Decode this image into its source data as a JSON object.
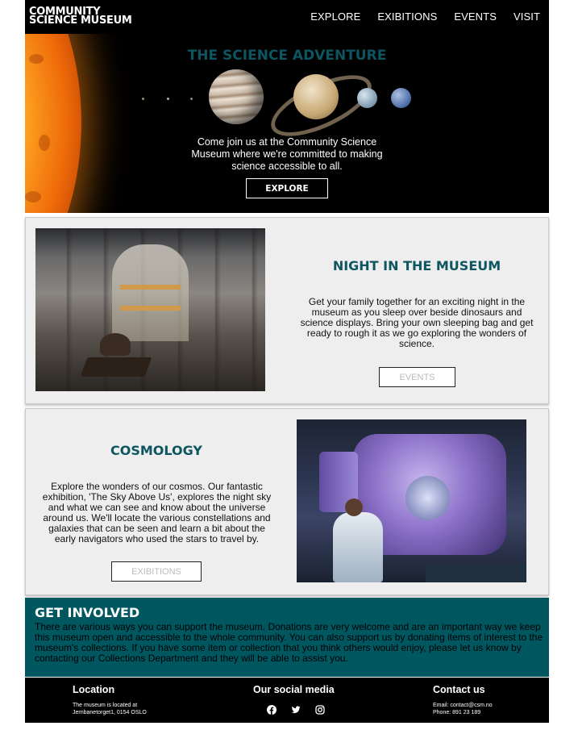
{
  "header": {
    "logo_line1": "COMMUNITY",
    "logo_line2": "SCIENCE MUSEUM",
    "nav": [
      "EXPLORE",
      "EXIBITIONS",
      "EVENTS",
      "VISIT"
    ]
  },
  "hero": {
    "title": "THE SCIENCE ADVENTURE",
    "text": "Come join us at the Community Science Museum where we're committed to making science accessible to all.",
    "button": "EXPLORE"
  },
  "night": {
    "title": "NIGHT IN THE MUSEUM",
    "text": "Get your family together for an exciting night in the museum as you sleep over beside dinosaurs and science displays. Bring your own sleeping bag and get ready to rough it as we go exploring the wonders of science.",
    "button": "EVENTS"
  },
  "cosmology": {
    "title": "COSMOLOGY",
    "text": "Explore the wonders of our cosmos. Our fantastic exhibition, 'The Sky Above Us', explores the night sky and what we can see and know about the universe around us. We'll locate the various constellations and galaxies that can be seen and learn a bit about the early navigators who used the stars to travel by.",
    "button": "EXIBITIONS"
  },
  "involved": {
    "title": "GET INVOLVED",
    "text": "There are various ways you can support the museum. Donations are very welcome and are an important way we keep this museum open and accessible to the whole community. You can also support us by donating items of interest to the museum's collections. If you have some item or collection that you think others would enjoy, please let us know by contacting our Collections Department and they will be able to assist you."
  },
  "footer": {
    "location_title": "Location",
    "location_line1": "The museum is located at",
    "location_line2": "Jernbanetorget1, 0154 OSLO",
    "social_title": "Our social media",
    "social_icons": [
      "facebook-icon",
      "twitter-icon",
      "instagram-icon"
    ],
    "contact_title": "Contact us",
    "contact_email": "Email: contact@csm.no",
    "contact_phone": "Phone: 891 23 189"
  },
  "colors": {
    "accent": "#005760",
    "title_teal": "#0d5560",
    "card_bg": "#eeeeee"
  }
}
